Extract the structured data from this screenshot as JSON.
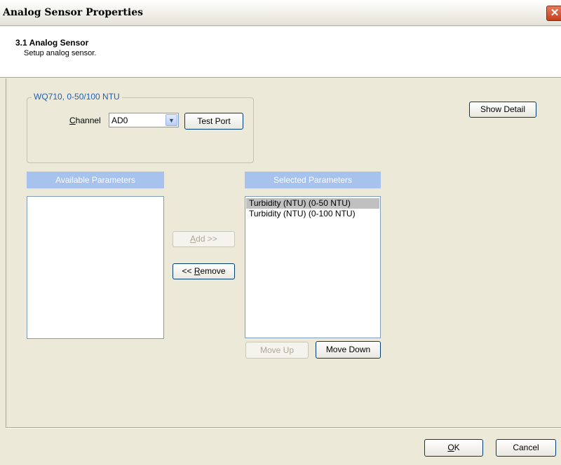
{
  "window": {
    "title": "Analog Sensor Properties",
    "close_glyph": "✕"
  },
  "header": {
    "title": "3.1 Analog Sensor",
    "subtitle": "Setup analog sensor."
  },
  "group": {
    "legend": "WQ710, 0-50/100 NTU",
    "channel_label_accel": "C",
    "channel_label_rest": "hannel",
    "channel_value": "AD0",
    "test_port_label": "Test Port"
  },
  "show_detail_label": "Show Detail",
  "available": {
    "header": "Available Parameters",
    "items": []
  },
  "selected": {
    "header": "Selected Parameters",
    "items": [
      {
        "label": "Turbidity (NTU)  (0-50 NTU)",
        "selected": true
      },
      {
        "label": "Turbidity (NTU)  (0-100 NTU)",
        "selected": false
      }
    ]
  },
  "buttons": {
    "add_accel": "A",
    "add_rest": "dd >>",
    "remove_prefix": "<< ",
    "remove_accel": "R",
    "remove_rest": "emove",
    "move_up": "Move Up",
    "move_down": "Move Down",
    "ok_accel": "O",
    "ok_rest": "K",
    "cancel": "Cancel"
  },
  "icons": {
    "dropdown_arrow": "chevron-down-icon",
    "close": "close-icon"
  },
  "colors": {
    "param_header_bg": "#a6c2ed",
    "legend_text": "#2160b9",
    "window_bg": "#ece9d8"
  }
}
